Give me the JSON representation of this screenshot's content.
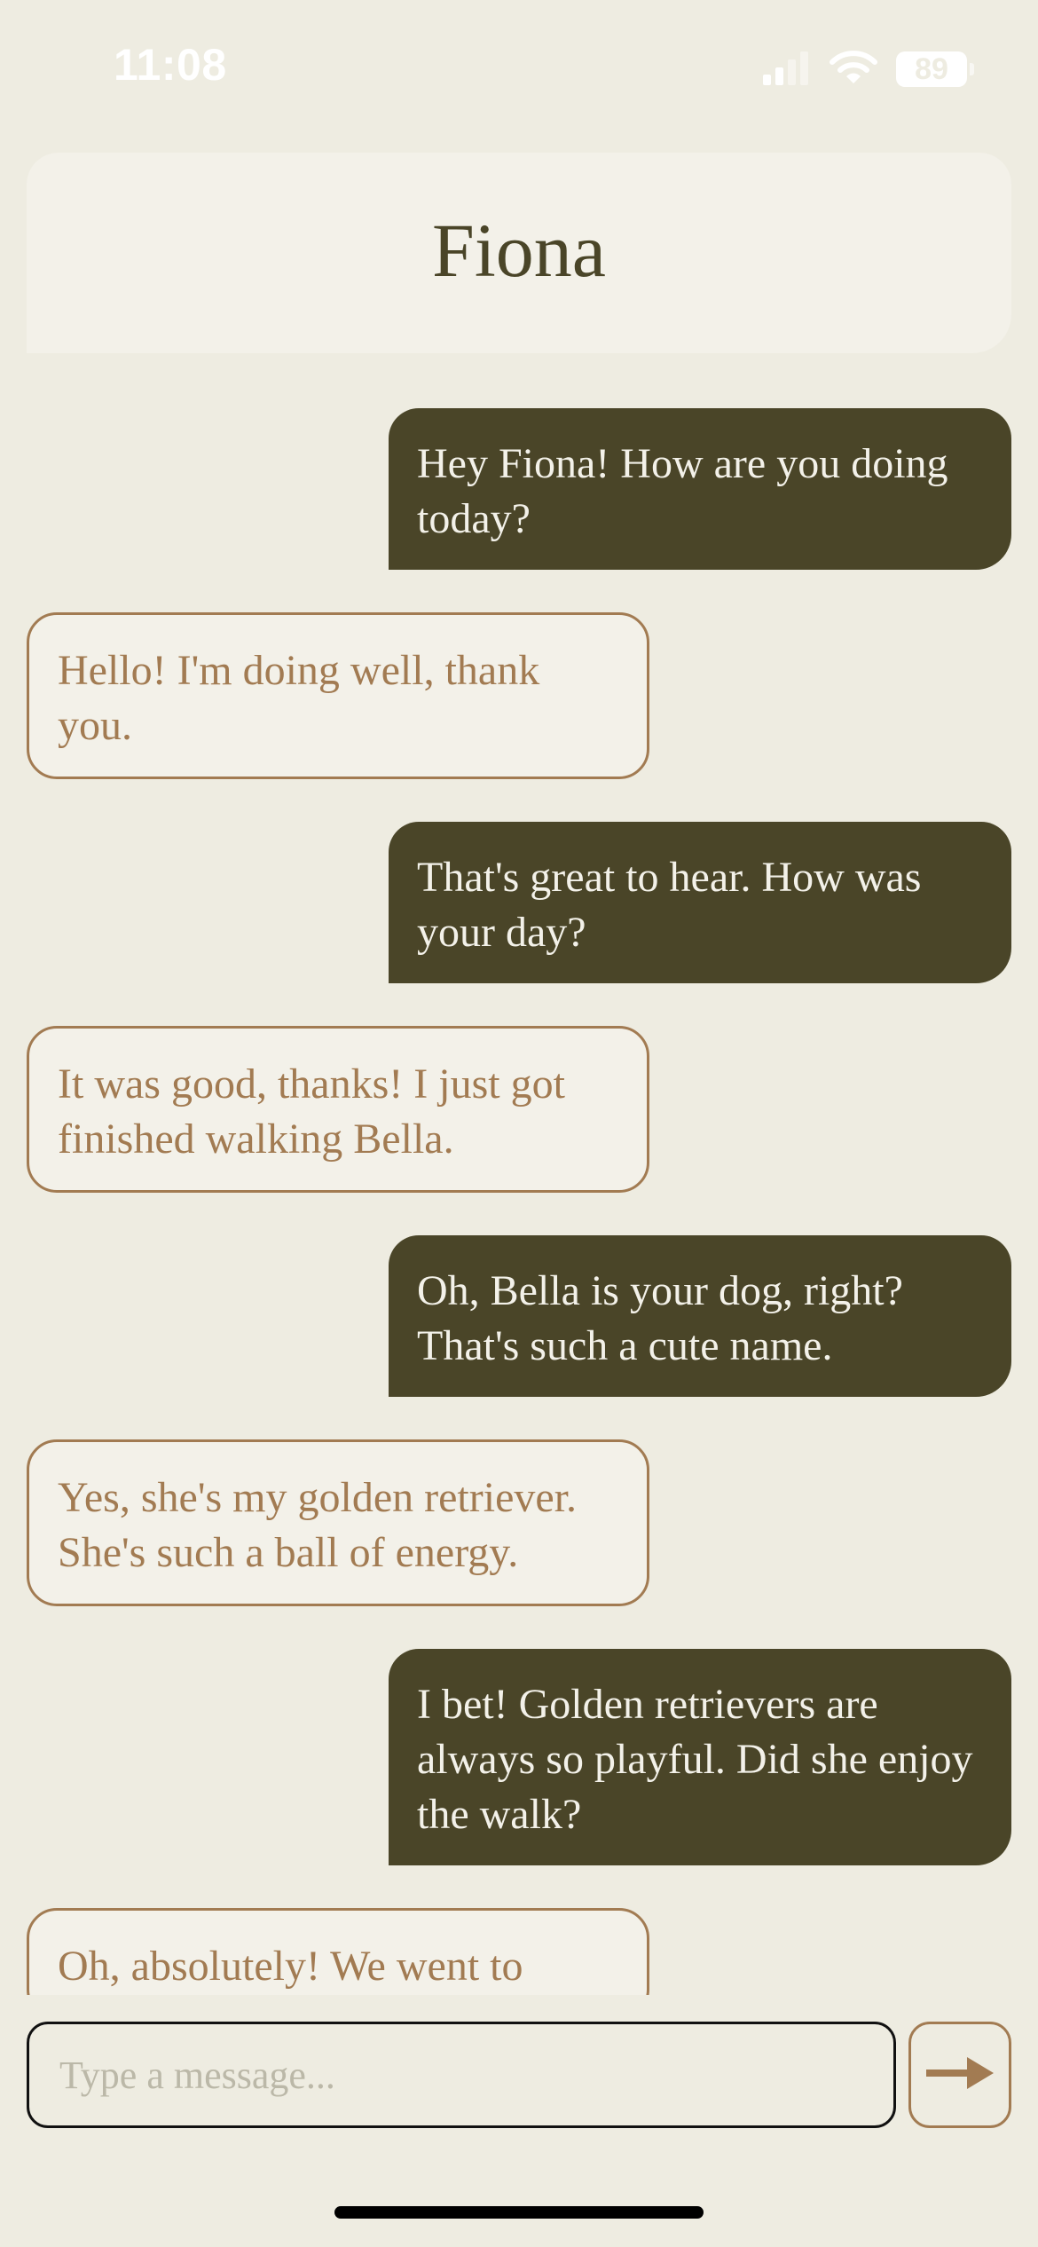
{
  "status_bar": {
    "time": "11:08",
    "battery": "89",
    "icons": [
      "signal-icon",
      "wifi-icon",
      "battery-icon"
    ]
  },
  "header": {
    "title": "Fiona"
  },
  "messages": [
    {
      "from": "me",
      "text": "Hey Fiona! How are you doing today?"
    },
    {
      "from": "contact",
      "text": "Hello! I'm doing well, thank you."
    },
    {
      "from": "me",
      "text": "That's great to hear. How was your day?"
    },
    {
      "from": "contact",
      "text": "It was good, thanks! I just got finished walking Bella."
    },
    {
      "from": "me",
      "text": "Oh, Bella is your dog, right? That's such a cute name."
    },
    {
      "from": "contact",
      "text": "Yes, she's my golden retriever. She's such a ball of energy."
    },
    {
      "from": "me",
      "text": "I bet! Golden retrievers are always so playful. Did she enjoy the walk?"
    },
    {
      "from": "contact",
      "text": "Oh, absolutely! We went to"
    }
  ],
  "composer": {
    "placeholder": "Type a message...",
    "value": "",
    "send_icon": "arrow-right-icon"
  },
  "colors": {
    "background": "#EEECE1",
    "header": "#F3F1E9",
    "sent_bubble": "#4A4528",
    "sent_text": "#F3F1E9",
    "received_border": "#A27B52",
    "received_text": "#A27B52"
  }
}
